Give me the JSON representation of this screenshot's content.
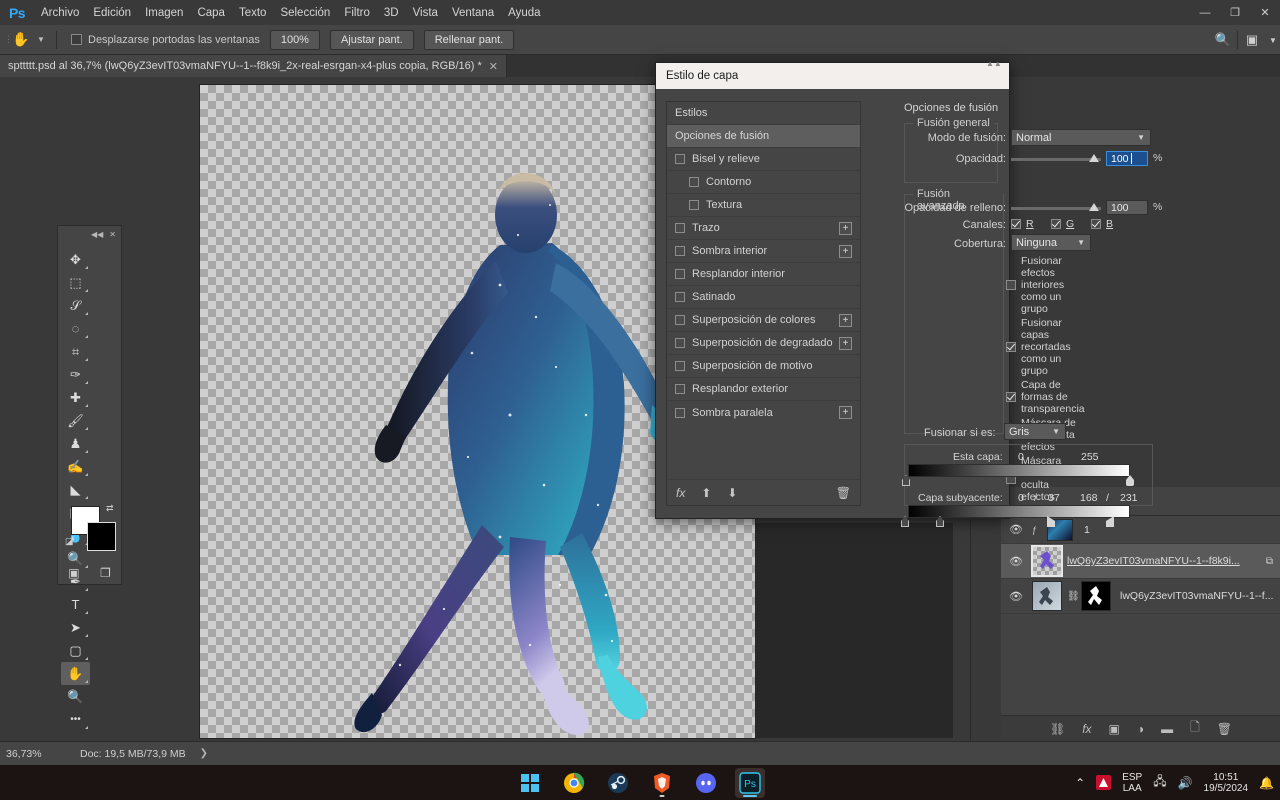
{
  "app": {
    "logo": "Ps",
    "menu": [
      "Archivo",
      "Edición",
      "Imagen",
      "Capa",
      "Texto",
      "Selección",
      "Filtro",
      "3D",
      "Vista",
      "Ventana",
      "Ayuda"
    ],
    "window_controls": {
      "minimize": "—",
      "maximize": "❐",
      "close": "✕"
    }
  },
  "options_bar": {
    "tool_icon": "hand-tool",
    "checkbox_label": "Desplazarse portodas las ventanas",
    "checkbox_checked": false,
    "zoom_button": "100%",
    "fit_button": "Ajustar pant.",
    "fill_button": "Rellenar pant.",
    "search_icon": "search-icon",
    "workspace_icon": "workspace-icon"
  },
  "document_tab": {
    "title": "spttttt.psd al 36,7% (lwQ6yZ3evIT03vmaNFYU--1--f8k9i_2x-real-esrgan-x4-plus copia, RGB/16) *",
    "close": "✕"
  },
  "tools": {
    "collapse_icon": "collapse-icon",
    "close_icon": "close-icon",
    "items": [
      {
        "name": "move-tool",
        "glyph": "✥"
      },
      {
        "name": "rectangular-marquee-tool",
        "glyph": "⬚"
      },
      {
        "name": "lasso-tool",
        "glyph": "𝒮"
      },
      {
        "name": "quick-selection-tool",
        "glyph": "◌"
      },
      {
        "name": "crop-tool",
        "glyph": "⌗"
      },
      {
        "name": "eyedropper-tool",
        "glyph": "✑"
      },
      {
        "name": "healing-brush-tool",
        "glyph": "✚"
      },
      {
        "name": "brush-tool",
        "glyph": "🖌"
      },
      {
        "name": "clone-stamp-tool",
        "glyph": "♟"
      },
      {
        "name": "history-brush-tool",
        "glyph": "✍"
      },
      {
        "name": "eraser-tool",
        "glyph": "◣"
      },
      {
        "name": "gradient-tool",
        "glyph": "▨"
      },
      {
        "name": "blur-tool",
        "glyph": "💧"
      },
      {
        "name": "dodge-tool",
        "glyph": "🔍"
      },
      {
        "name": "pen-tool",
        "glyph": "✒"
      },
      {
        "name": "type-tool",
        "glyph": "T"
      },
      {
        "name": "path-selection-tool",
        "glyph": "➤"
      },
      {
        "name": "rectangle-tool",
        "glyph": "▢"
      },
      {
        "name": "hand-tool",
        "glyph": "✋"
      },
      {
        "name": "zoom-tool",
        "glyph": "🔍"
      },
      {
        "name": "edit-toolbar",
        "glyph": "•••"
      }
    ],
    "foreground_color": "#ffffff",
    "background_color": "#000000",
    "swap_icon": "swap-colors-icon",
    "default_icon": "default-colors-icon",
    "quickmask_icon": "quick-mask-icon",
    "screenmode_icon": "screen-mode-icon"
  },
  "canvas": {
    "selection_color": "#b07ad0",
    "transparency": "checkerboard"
  },
  "dialog": {
    "title": "Estilo de capa",
    "effects_list": [
      {
        "label": "Estilos",
        "type": "header",
        "checkbox": false,
        "plus": false,
        "selected": false,
        "indent": false
      },
      {
        "label": "Opciones de fusión",
        "type": "header",
        "checkbox": false,
        "plus": false,
        "selected": true,
        "indent": false
      },
      {
        "label": "Bisel y relieve",
        "type": "effect",
        "checkbox": true,
        "checked": false,
        "plus": false,
        "indent": false
      },
      {
        "label": "Contorno",
        "type": "effect",
        "checkbox": true,
        "checked": false,
        "plus": false,
        "indent": true
      },
      {
        "label": "Textura",
        "type": "effect",
        "checkbox": true,
        "checked": false,
        "plus": false,
        "indent": true
      },
      {
        "label": "Trazo",
        "type": "effect",
        "checkbox": true,
        "checked": false,
        "plus": true,
        "indent": false
      },
      {
        "label": "Sombra interior",
        "type": "effect",
        "checkbox": true,
        "checked": false,
        "plus": true,
        "indent": false
      },
      {
        "label": "Resplandor interior",
        "type": "effect",
        "checkbox": true,
        "checked": false,
        "plus": false,
        "indent": false
      },
      {
        "label": "Satinado",
        "type": "effect",
        "checkbox": true,
        "checked": false,
        "plus": false,
        "indent": false
      },
      {
        "label": "Superposición de colores",
        "type": "effect",
        "checkbox": true,
        "checked": false,
        "plus": true,
        "indent": false
      },
      {
        "label": "Superposición de degradado",
        "type": "effect",
        "checkbox": true,
        "checked": false,
        "plus": true,
        "indent": false
      },
      {
        "label": "Superposición de motivo",
        "type": "effect",
        "checkbox": true,
        "checked": false,
        "plus": false,
        "indent": false
      },
      {
        "label": "Resplandor exterior",
        "type": "effect",
        "checkbox": true,
        "checked": false,
        "plus": false,
        "indent": false
      },
      {
        "label": "Sombra paralela",
        "type": "effect",
        "checkbox": true,
        "checked": false,
        "plus": true,
        "indent": false
      }
    ],
    "list_footer": {
      "fx": "fx",
      "up": "⬆",
      "down": "⬇",
      "trash": "🗑"
    },
    "options": {
      "panel_title": "Opciones de fusión",
      "general_legend": "Fusión general",
      "blend_mode_label": "Modo de fusión:",
      "blend_mode_value": "Normal",
      "opacity_label": "Opacidad:",
      "opacity_value": "100",
      "opacity_unit": "%",
      "advanced_legend": "Fusión avanzada",
      "fill_opacity_label": "Opacidad de relleno:",
      "fill_opacity_value": "100",
      "fill_opacity_unit": "%",
      "channels_label": "Canales:",
      "channels": [
        {
          "label": "R",
          "checked": true
        },
        {
          "label": "G",
          "checked": true
        },
        {
          "label": "B",
          "checked": true
        }
      ],
      "knockout_label": "Cobertura:",
      "knockout_value": "Ninguna",
      "checkboxes": [
        {
          "label": "Fusionar efectos interiores como un grupo",
          "checked": false
        },
        {
          "label": "Fusionar capas recortadas como un grupo",
          "checked": true
        },
        {
          "label": "Capa de formas de transparencia",
          "checked": true
        },
        {
          "label": "Máscara de capa oculta efectos",
          "checked": false
        },
        {
          "label": "Máscara vectorial oculta efectos",
          "checked": false
        }
      ],
      "blend_if_label": "Fusionar si es:",
      "blend_if_value": "Gris",
      "this_layer_label": "Esta capa:",
      "this_layer_min": "0",
      "this_layer_max": "255",
      "underlying_layer_label": "Capa subyacente:",
      "underlying_values": [
        "0",
        "/",
        "37",
        "168",
        "/",
        "231"
      ]
    }
  },
  "layers_panel": {
    "rows": [
      {
        "visible": true,
        "name": "1",
        "thumb": "space-thumb",
        "has_fx": true,
        "selected": false,
        "underline": false,
        "mask": false
      },
      {
        "visible": true,
        "name": "lwQ6yZ3evIT03vmaNFYU--1--f8k9i...",
        "thumb": "figure-thumb",
        "selected": true,
        "underline": true,
        "mask": false,
        "clip_icon": true
      },
      {
        "visible": true,
        "name": "lwQ6yZ3evIT03vmaNFYU--1--f...",
        "thumb": "figure-thumb2",
        "selected": false,
        "underline": false,
        "mask": true
      }
    ],
    "footer_icons": [
      "link-icon",
      "fx-icon",
      "mask-icon",
      "adjustment-icon",
      "folder-icon",
      "new-layer-icon",
      "trash-icon"
    ]
  },
  "status_bar": {
    "zoom": "36,73%",
    "doc_info": "Doc: 19,5 MB/73,9 MB",
    "arrow": "❯"
  },
  "taskbar": {
    "apps": [
      {
        "name": "start-button",
        "glyph": "⊞"
      },
      {
        "name": "chrome-taskbar-icon",
        "glyph": "◉"
      },
      {
        "name": "steam-taskbar-icon",
        "glyph": "◍"
      },
      {
        "name": "brave-taskbar-icon",
        "glyph": "🦁"
      },
      {
        "name": "discord-taskbar-icon",
        "glyph": "◕"
      },
      {
        "name": "photoshop-taskbar-icon",
        "glyph": "Ps"
      }
    ],
    "tray": {
      "chevron": "⌃",
      "red_icon": "A",
      "language_line1": "ESP",
      "language_line2": "LAA",
      "network_icon": "network-icon",
      "volume_icon": "volume-icon",
      "time": "10:51",
      "date": "19/5/2024",
      "notification_icon": "notification-icon"
    }
  }
}
